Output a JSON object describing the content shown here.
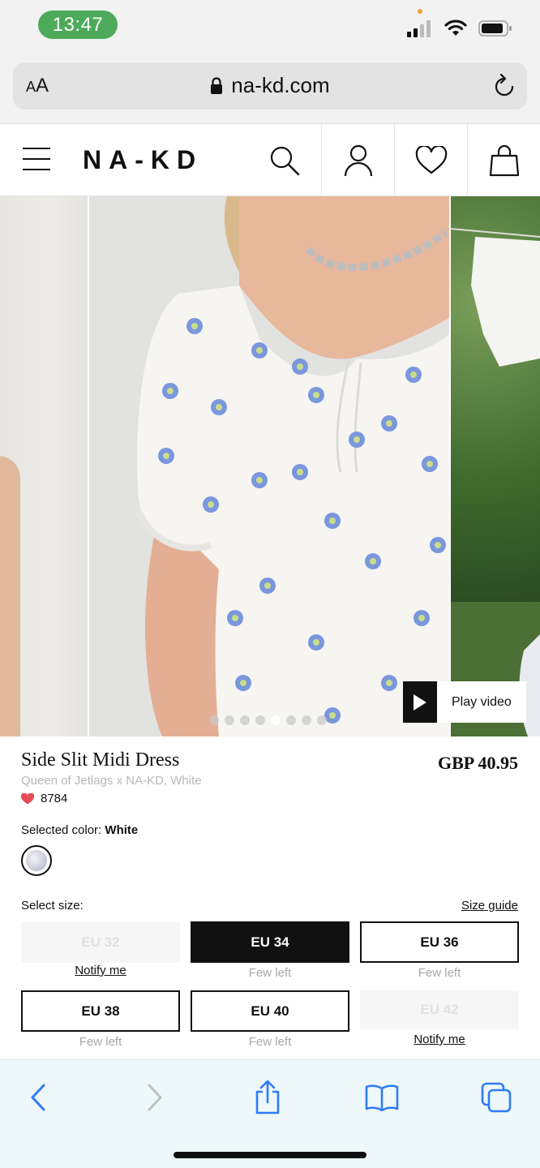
{
  "status_bar": {
    "time": "13:47",
    "icons": [
      "signal-icon",
      "wifi-icon",
      "battery-icon"
    ]
  },
  "browser": {
    "text_size_label_small": "A",
    "text_size_label_large": "A",
    "url": "na-kd.com",
    "icons": [
      "lock-icon",
      "reload-icon"
    ]
  },
  "site_header": {
    "logo": "NA-KD",
    "icons": [
      "menu-icon",
      "search-icon",
      "account-icon",
      "wishlist-heart-icon",
      "shopping-bag-icon"
    ]
  },
  "carousel": {
    "play_video_label": "Play video",
    "slide_count": 8,
    "active_slide": 5
  },
  "product": {
    "title": "Side Slit Midi Dress",
    "brand": "Queen of Jetlags x NA-KD, White",
    "likes": "8784",
    "price": "GBP 40.95",
    "selected_color_label": "Selected color:",
    "selected_color_value": "White",
    "select_size_label": "Select size:",
    "size_guide_label": "Size guide",
    "sizes": [
      {
        "label": "EU 32",
        "state": "out-of-stock",
        "note": "Notify me"
      },
      {
        "label": "EU 34",
        "state": "selected",
        "note": "Few left"
      },
      {
        "label": "EU 36",
        "state": "available",
        "note": "Few left"
      },
      {
        "label": "EU 38",
        "state": "available",
        "note": "Few left"
      },
      {
        "label": "EU 40",
        "state": "available",
        "note": "Few left"
      },
      {
        "label": "EU 42",
        "state": "out-of-stock",
        "note": "Notify me"
      }
    ]
  },
  "browser_toolbar": {
    "icons": [
      "back-arrow-icon",
      "forward-arrow-icon",
      "share-icon",
      "bookmarks-icon",
      "tabs-icon"
    ]
  },
  "colors": {
    "time_pill": "#4caa5a",
    "safari_link_blue": "#2f7cf6",
    "like_heart": "#e54b57",
    "selected_size_bg": "#111111"
  }
}
